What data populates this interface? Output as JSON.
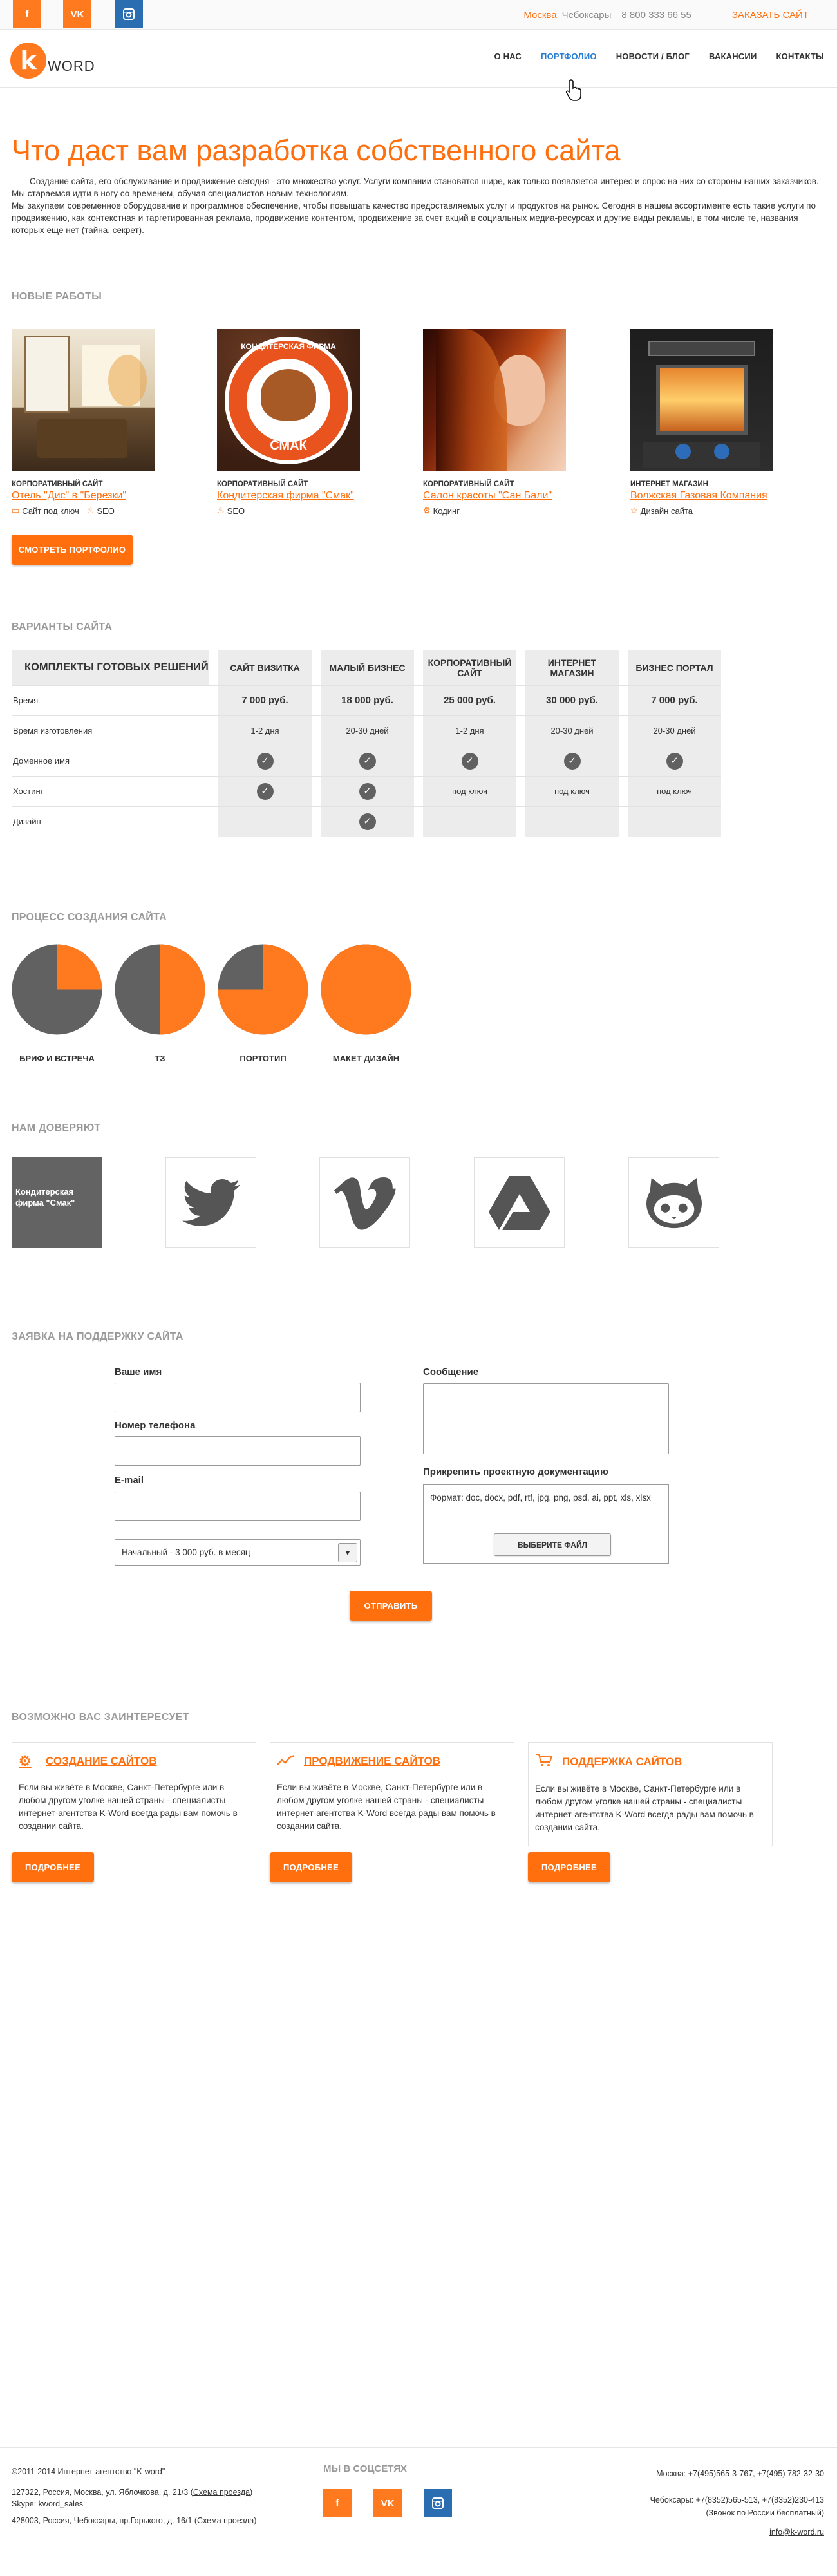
{
  "colors": {
    "accent": "#ff6f0e",
    "nav_active": "#2a7fd4",
    "check": "#616161",
    "fb": "#ff7a1f",
    "vk": "#ff7a1f",
    "inst": "#2a6db0"
  },
  "topbar": {
    "social": [
      {
        "icon": "facebook-icon",
        "label": "f"
      },
      {
        "icon": "vk-icon",
        "label": "VK"
      },
      {
        "icon": "instagram-icon",
        "label": ""
      }
    ],
    "city_active": "Москва",
    "city_other": "Чебоксары",
    "phone": "8 800 333 66 55",
    "order": "ЗАКАЗАТЬ САЙТ"
  },
  "header": {
    "logo_letter": "k",
    "logo_word": "WORD",
    "nav": [
      "О НАС",
      "ПОРТФОЛИО",
      "НОВОСТИ / БЛОГ",
      "ВАКАНСИИ",
      "КОНТАКТЫ"
    ]
  },
  "intro": {
    "title": "Что даст вам разработка собственного сайта",
    "p1": "Создание сайта, его обслуживание и продвижение сегодня - это множество услуг. Услуги компании становятся шире, как только появляется интерес и спрос на них со стороны наших заказчиков. Мы стараемся идти в ногу со временем, обучая специалистов новым технологиям.",
    "p2": "Мы закупаем современное оборудование и программное обеспечение, чтобы повышать качество предоставляемых услуг и продуктов на рынок. Сегодня в нашем ассортименте есть такие услуги по продвижению, как контекстная и таргетированная реклама, продвижение контентом, продвижение за счет акций в социальных медиа-ресурсах и другие виды рекламы, в том числе те, названия которых еще нет (тайна, секрет)."
  },
  "works": {
    "heading": "НОВЫЕ РАБОТЫ",
    "button": "СМОТРЕТЬ ПОРТФОЛИО",
    "items": [
      {
        "cat": "КОРПОРАТИВНЫЙ САЙТ",
        "name": "Отель \"Дис\" в \"Березки\"",
        "tags": [
          {
            "icon": "monitor-icon",
            "text": "Сайт под ключ"
          },
          {
            "icon": "flame-icon",
            "text": "SEO"
          }
        ]
      },
      {
        "cat": "КОРПОРАТИВНЫЙ САЙТ",
        "name": "Кондитерская фирма \"Смак\"",
        "tags": [
          {
            "icon": "flame-icon",
            "text": "SEO"
          }
        ]
      },
      {
        "cat": "КОРПОРАТИВНЫЙ САЙТ",
        "name": "Салон красоты \"Сан Бали\"",
        "tags": [
          {
            "icon": "code-icon",
            "text": "Кодинг"
          }
        ]
      },
      {
        "cat": "ИНТЕРНЕТ МАГАЗИН",
        "name": "Волжская Газовая Компания",
        "tags": [
          {
            "icon": "star-icon",
            "text": "Дизайн сайта"
          }
        ]
      }
    ],
    "smak_badge": {
      "top": "КОНДИТЕРСКАЯ ФИРМА",
      "bottom": "СМАК"
    }
  },
  "pricing": {
    "heading": "ВАРИАНТЫ САЙТА",
    "first": "КОМПЛЕКТЫ ГОТОВЫХ РЕШЕНИЙ",
    "plans": [
      "САЙТ ВИЗИТКА",
      "МАЛЫЙ БИЗНЕС",
      "КОРПОРАТИВНЫЙ САЙТ",
      "ИНТЕРНЕТ МАГАЗИН",
      "БИЗНЕС ПОРТАЛ"
    ],
    "rows": [
      {
        "label": "Время",
        "values": [
          "7 000 руб.",
          "18 000 руб.",
          "25 000 руб.",
          "30 000 руб.",
          "7 000 руб."
        ]
      },
      {
        "label": "Время изготовления",
        "values": [
          "1-2 дня",
          "20-30 дней",
          "1-2 дня",
          "20-30 дней",
          "20-30 дней"
        ]
      },
      {
        "label": "Доменное имя",
        "values": [
          "check",
          "check",
          "check",
          "check",
          "check"
        ]
      },
      {
        "label": "Хостинг",
        "values": [
          "check",
          "check",
          "под ключ",
          "под ключ",
          "под ключ"
        ]
      },
      {
        "label": "Дизайн",
        "values": [
          "dash",
          "check",
          "dash",
          "dash",
          "dash"
        ]
      }
    ]
  },
  "process": {
    "heading": "ПРОЦЕСС СОЗДАНИЯ САЙТА",
    "steps": [
      {
        "label": "БРИФ И ВСТРЕЧА",
        "fill": 0.25
      },
      {
        "label": "ТЗ",
        "fill": 0.5
      },
      {
        "label": "ПОРТОТИП",
        "fill": 0.75
      },
      {
        "label": "МАКЕТ ДИЗАЙН",
        "fill": 1.0
      }
    ]
  },
  "trust": {
    "heading": "НАМ ДОВЕРЯЮТ",
    "first_label": "Кондитерская фирма \"Смак\"",
    "logos": [
      "twitter-icon",
      "vimeo-icon",
      "google-drive-icon",
      "github-icon"
    ]
  },
  "form": {
    "heading": "ЗАЯВКА НА ПОДДЕРЖКУ САЙТА",
    "name": "Ваше имя",
    "phone": "Номер телефона",
    "email": "E-mail",
    "select": "Начальный - 3 000 руб. в месяц",
    "message": "Сообщение",
    "attach": "Прикрепить проектную документацию",
    "formats": "Формат: doc, docx, pdf, rtf, jpg, png, psd, ai, ppt, xls, xlsx",
    "choose": "ВЫБЕРИТЕ ФАЙЛ",
    "submit": "ОТПРАВИТЬ"
  },
  "interest": {
    "heading": "ВОЗМОЖНО ВАС ЗАИНТЕРЕСУЕТ",
    "button": "ПОДРОБНЕЕ",
    "text": "Если вы живёте в Москве, Санкт-Петербурге или в любом другом уголке нашей страны - специалисты интернет-агентства K-Word всегда рады вам помочь в создании сайта.",
    "cards": [
      {
        "icon": "gear-icon",
        "title": "СОЗДАНИЕ САЙТОВ"
      },
      {
        "icon": "chart-icon",
        "title": "ПРОДВИЖЕНИЕ САЙТОВ"
      },
      {
        "icon": "cart-icon",
        "title": "ПОДДЕРЖКА САЙТОВ"
      }
    ]
  },
  "footer": {
    "copy": "©2011-2014 Интернет-агентство \"K-word\"",
    "addr1": "127322, Россия, Москва, ул. Яблочкова, д. 21/3",
    "scheme": "Схема проезда",
    "skype": "Skype: kword_sales",
    "addr2": "428003, Россия, Чебоксары, пр.Горького, д. 16/1",
    "social_heading": "МЫ В СОЦСЕТЯХ",
    "social": [
      "f",
      "VK",
      ""
    ],
    "moscow": "Москва: +7(495)565-3-767, +7(495) 782-32-30",
    "cheb": "Чебоксары: +7(8352)565-513, +7(8352)230-413",
    "free": "(Звонок по России бесплатный)",
    "email": "info@k-word.ru"
  }
}
